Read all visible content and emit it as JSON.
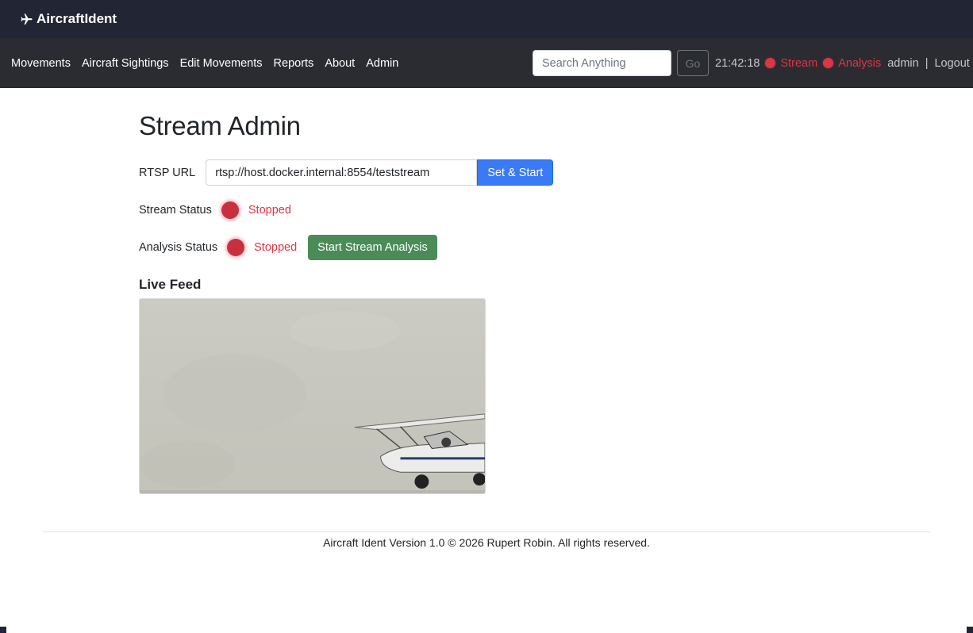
{
  "app": {
    "brand": "AircraftIdent",
    "brand_icon": "airplane-icon"
  },
  "nav": {
    "links": [
      "Movements",
      "Aircraft Sightings",
      "Edit Movements",
      "Reports",
      "About",
      "Admin"
    ],
    "search_placeholder": "Search Anything",
    "go_label": "Go",
    "clock": "21:42:18",
    "stream_label": "Stream",
    "analysis_label": "Analysis",
    "user": "admin",
    "separator": "|",
    "logout_label": "Logout"
  },
  "page": {
    "title": "Stream Admin",
    "rtsp_label": "RTSP URL",
    "rtsp_value": "rtsp://host.docker.internal:8554/teststream",
    "set_start_label": "Set & Start",
    "stream_status_label": "Stream Status",
    "stream_status_value": "Stopped",
    "analysis_status_label": "Analysis Status",
    "analysis_status_value": "Stopped",
    "start_analysis_label": "Start Stream Analysis",
    "live_feed_heading": "Live Feed"
  },
  "footer": {
    "text": "Aircraft Ident Version 1.0 © 2026 Rupert Robin. All rights reserved."
  },
  "colors": {
    "accent": "#3b7af5",
    "danger": "#dc3545",
    "success": "#4a8b57",
    "topbar": "#222533",
    "navbar": "#2b2c31"
  }
}
